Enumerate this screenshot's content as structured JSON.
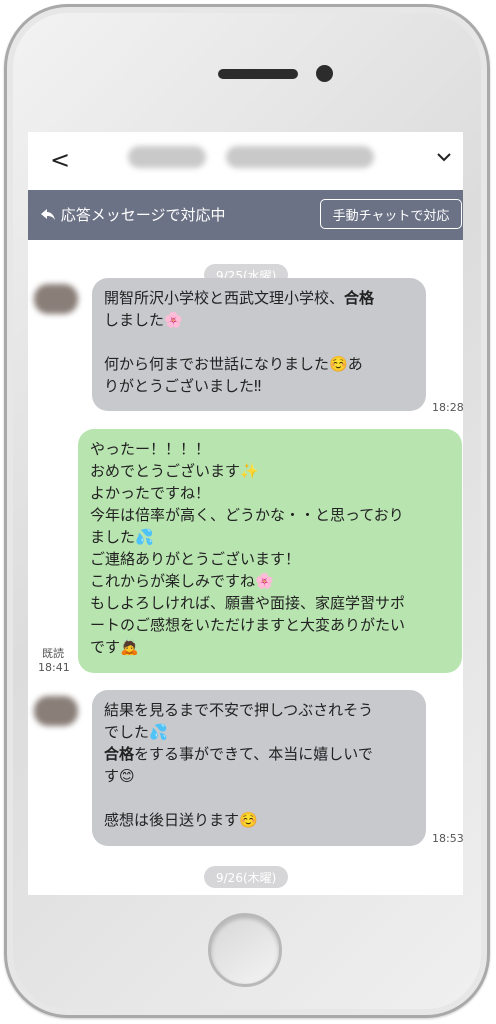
{
  "header": {
    "back_label": "<",
    "chevron_icon": "chevron-down-icon"
  },
  "status": {
    "text": "応答メッセージで対応中",
    "reply_icon": "reply-arrow-icon",
    "manual_button": "手動チャットで対応"
  },
  "chat": {
    "date_top": "9/25(水曜)",
    "date_bottom": "9/26(木曜)",
    "messages": [
      {
        "line1a": "開智所沢小学校と西武文理小学校、",
        "line1b": "合格",
        "line2": "しました",
        "emoji_flower": "🌸",
        "line3": "何から何までお世話になりました",
        "emoji_smile": "☺️",
        "line3b": "あ",
        "line4": "りがとうございました‼",
        "time": "18:28"
      },
      {
        "text1": "やったー！！！！",
        "text2": "おめでとうございます",
        "emoji_sparkle": "✨",
        "text3": "よかったですね！",
        "text4": "今年は倍率が高く、どうかな・・と思っており",
        "text5": "ました",
        "emoji_sweat": "💦",
        "text6": "ご連絡ありがとうございます！",
        "text7": "これからが楽しみですね",
        "emoji_flower": "🌸",
        "text8": "もしよろしければ、願書や面接、家庭学習サポ",
        "text9": "ートのご感想をいただけますと大変ありがたい",
        "text10": "です",
        "emoji_bow": "🙇",
        "read": "既読",
        "time": "18:41"
      },
      {
        "line1": "結果を見るまで不安で押しつぶされそう",
        "line2": "でした",
        "emoji_sweat": "💦",
        "line3a": "合格",
        "line3b": "をする事ができて、本当に嬉しいで",
        "line4": "す",
        "emoji_smile": "😊",
        "line5": "感想は後日送ります",
        "emoji_relieved": "☺️",
        "time": "18:53"
      }
    ]
  }
}
